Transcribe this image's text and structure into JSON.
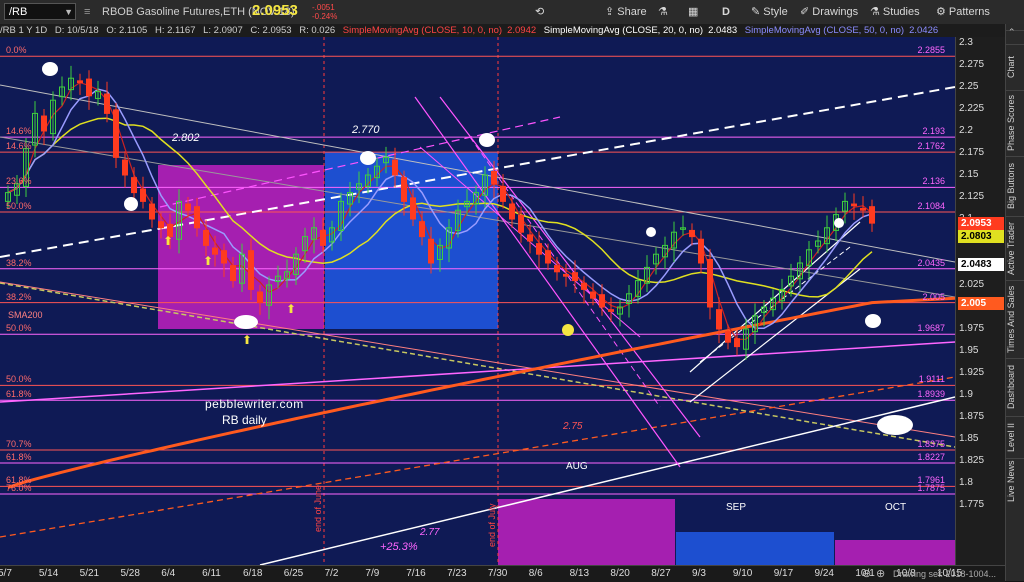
{
  "toolbar": {
    "symbol": "/RB",
    "instrument": "RBOB Gasoline Futures,ETH (NOV 18)",
    "last_price": "2.0953",
    "change": "-.0051",
    "change_pct": "-0.24%",
    "share": "Share",
    "interval": "D",
    "style": "Style",
    "drawings": "Drawings",
    "studies": "Studies",
    "patterns": "Patterns"
  },
  "status_bar": {
    "period": "/RB 1 Y 1D",
    "date": "D: 10/5/18",
    "open": "O: 2.1105",
    "high": "H: 2.1167",
    "low": "L: 2.0907",
    "close": "C: 2.0953",
    "range": "R: 0.026",
    "sma1_label": "SimpleMovingAvg (CLOSE, 10, 0, no)",
    "sma1_value": "2.0942",
    "sma2_label": "SimpleMovingAvg (CLOSE, 20, 0, no)",
    "sma2_value": "2.0483",
    "sma3_label": "SimpleMovingAvg (CLOSE, 50, 0, no)",
    "sma3_value": "2.0426"
  },
  "colors": {
    "background": "#0f1a55",
    "up_candle": "#3ecf3e",
    "down_candle": "#ff3b1f",
    "sma10": "#cc2222",
    "sma20": "#9a9cff",
    "sma50": "#e0e020",
    "sma200": "#ff5a1f",
    "magenta_box": "#a51fb0",
    "blue_box": "#1d4fd0",
    "fib_line": "#ff5555"
  },
  "chart_data": {
    "type": "candlestick",
    "ylim": [
      1.75,
      2.3
    ],
    "yticks": [
      "2.3",
      "2.275",
      "2.25",
      "2.225",
      "2.2",
      "2.175",
      "2.15",
      "2.125",
      "2.1",
      "2.075",
      "2.05",
      "2.025",
      "2",
      "1.975",
      "1.95",
      "1.925",
      "1.9",
      "1.875",
      "1.85",
      "1.825",
      "1.8",
      "1.775"
    ],
    "x_labels": [
      "5/7",
      "5/14",
      "5/21",
      "5/28",
      "6/4",
      "6/11",
      "6/18",
      "6/25",
      "7/2",
      "7/9",
      "7/16",
      "7/23",
      "7/30",
      "8/6",
      "8/13",
      "8/20",
      "8/27",
      "9/3",
      "9/10",
      "9/17",
      "9/24",
      "10/1",
      "10/8",
      "10/15"
    ],
    "closes": [
      2.13,
      2.14,
      2.18,
      2.22,
      2.2,
      2.235,
      2.25,
      2.26,
      2.255,
      2.24,
      2.245,
      2.22,
      2.17,
      2.15,
      2.13,
      2.12,
      2.1,
      2.09,
      2.08,
      2.12,
      2.11,
      2.09,
      2.07,
      2.06,
      2.05,
      2.03,
      2.06,
      2.02,
      2.005,
      2.025,
      2.035,
      2.04,
      2.06,
      2.08,
      2.09,
      2.07,
      2.09,
      2.12,
      2.13,
      2.14,
      2.15,
      2.16,
      2.17,
      2.15,
      2.12,
      2.1,
      2.08,
      2.05,
      2.07,
      2.09,
      2.11,
      2.12,
      2.13,
      2.15,
      2.14,
      2.12,
      2.1,
      2.085,
      2.075,
      2.06,
      2.05,
      2.04,
      2.035,
      2.03,
      2.02,
      2.01,
      2.0,
      1.995,
      2.0,
      2.015,
      2.03,
      2.045,
      2.06,
      2.07,
      2.085,
      2.09,
      2.08,
      2.05,
      2.0,
      1.975,
      1.96,
      1.955,
      1.975,
      1.99,
      2.0,
      2.01,
      2.02,
      2.035,
      2.05,
      2.065,
      2.075,
      2.09,
      2.105,
      2.12,
      2.115,
      2.11,
      2.0953
    ],
    "h_levels": [
      {
        "label": "0.0%",
        "price": "2.2855",
        "value": 2.285
      },
      {
        "label": "14.6%",
        "price": "2.193",
        "value": 2.193
      },
      {
        "label": "14.6%",
        "price": "2.1762",
        "value": 2.176
      },
      {
        "label": "23.6%",
        "price": "2.136",
        "value": 2.136
      },
      {
        "label": "50.0%",
        "price": "2.1084",
        "value": 2.108
      },
      {
        "label": "38.2%",
        "price": "2.0435",
        "value": 2.0435
      },
      {
        "label": "38.2%",
        "price": "2.005",
        "value": 2.005
      },
      {
        "label": "50.0%",
        "price": "1.9687",
        "value": 1.969
      },
      {
        "label": "50.0%",
        "price": "1.9111",
        "value": 1.911
      },
      {
        "label": "61.8%",
        "price": "1.8939",
        "value": 1.894
      },
      {
        "label": "70.7%",
        "price": "1.8375",
        "value": 1.8375
      },
      {
        "label": "61.8%",
        "price": "1.8227",
        "value": 1.8227
      },
      {
        "label": "61.8%",
        "price": "1.7961",
        "value": 1.7961
      },
      {
        "label": "76.0%",
        "price": "1.7875",
        "value": 1.7875
      }
    ],
    "annotations": [
      "2.802",
      "2.770",
      "2.75",
      "2.77",
      "+25.3%",
      "AUG",
      "SEP",
      "OCT",
      "end of June",
      "end of July",
      "SMA200"
    ],
    "price_tags": [
      {
        "price": "2.0953",
        "value": 2.0953
      },
      {
        "price": "2.0803",
        "value": 2.0803
      },
      {
        "price": "2.0483",
        "value": 2.0483
      },
      {
        "price": "2.005",
        "value": 2.005
      }
    ]
  },
  "watermark": {
    "line1": "pebblewriter.com",
    "line2": "RB daily"
  },
  "sidebar_tabs": [
    "Chart",
    "Phase Scores",
    "Big Buttons",
    "Active Trader",
    "Times And Sales",
    "Dashboard",
    "Level II",
    "Live News"
  ],
  "footer": {
    "drawing_set": "Drawing set: 2018-1004..."
  }
}
